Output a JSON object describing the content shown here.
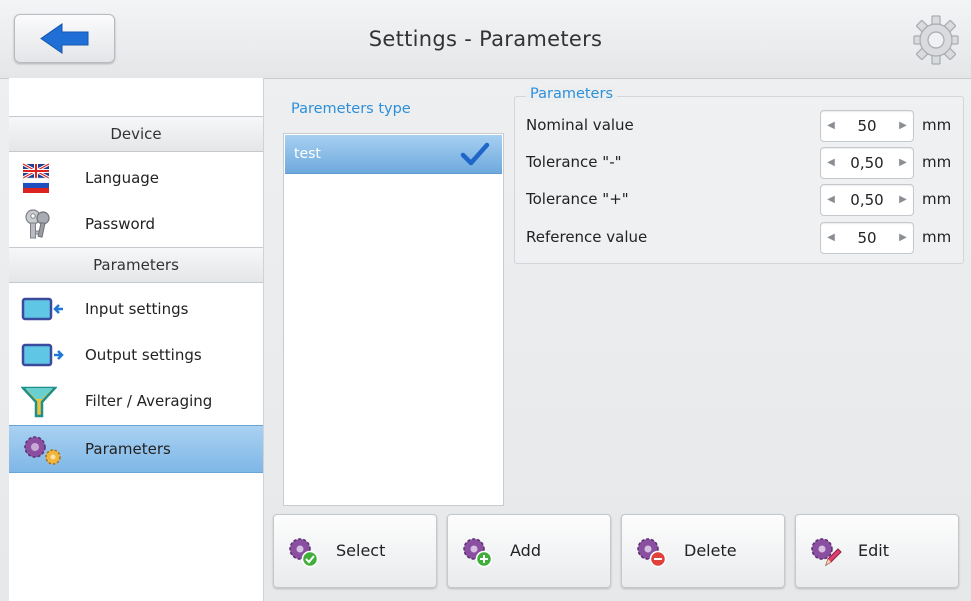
{
  "header": {
    "title": "Settings - Parameters"
  },
  "sidebar": {
    "sections": [
      {
        "title": "Device",
        "items": [
          {
            "label": "Language"
          },
          {
            "label": "Password"
          }
        ]
      },
      {
        "title": "Parameters",
        "items": [
          {
            "label": "Input settings"
          },
          {
            "label": "Output settings"
          },
          {
            "label": "Filter / Averaging"
          },
          {
            "label": "Parameters"
          }
        ]
      }
    ],
    "active_item": "Parameters"
  },
  "params_type": {
    "label": "Paremeters type",
    "items": [
      {
        "label": "test",
        "selected": true
      }
    ]
  },
  "parameters": {
    "legend": "Parameters",
    "rows": [
      {
        "label": "Nominal value",
        "value": "50",
        "unit": "mm"
      },
      {
        "label": "Tolerance \"-\"",
        "value": "0,50",
        "unit": "mm"
      },
      {
        "label": "Tolerance \"+\"",
        "value": "0,50",
        "unit": "mm"
      },
      {
        "label": "Reference value",
        "value": "50",
        "unit": "mm"
      }
    ]
  },
  "buttons": {
    "select": "Select",
    "add": "Add",
    "delete": "Delete",
    "edit": "Edit"
  },
  "colors": {
    "accent": "#2e8fd9",
    "selection": "#7fb7e6",
    "back_arrow": "#1f6fd6",
    "gear_purple": "#8a4fa0"
  }
}
